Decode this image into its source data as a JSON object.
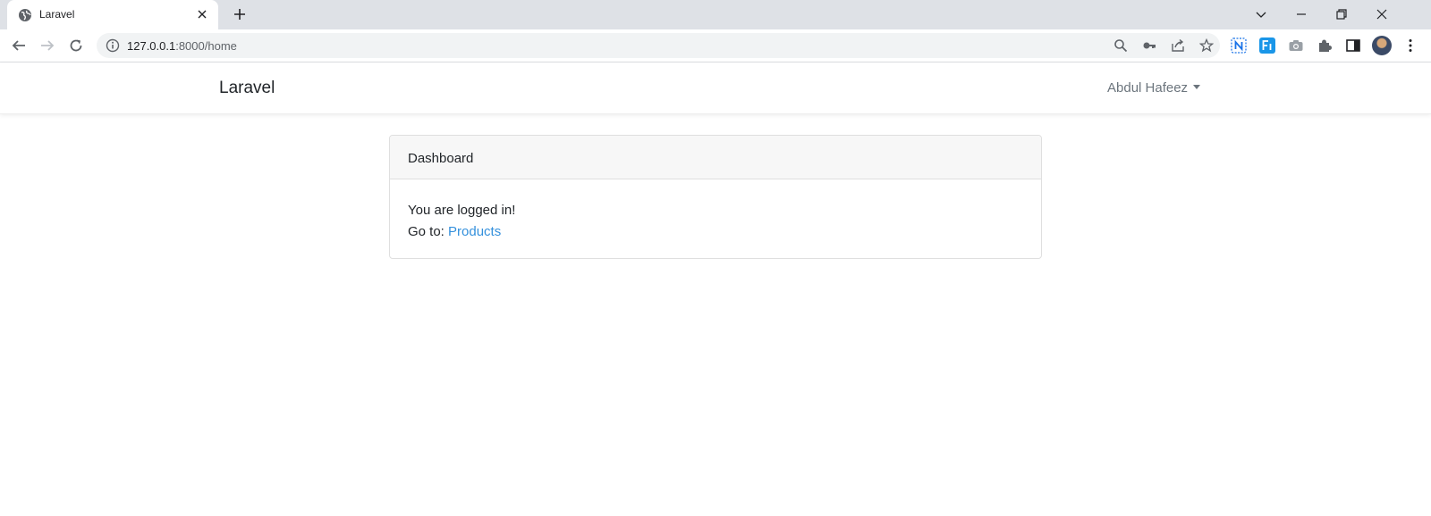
{
  "browser": {
    "tab_title": "Laravel",
    "url_host": "127.0.0.1",
    "url_rest": ":8000/home"
  },
  "navbar": {
    "brand": "Laravel",
    "user_name": "Abdul Hafeez"
  },
  "card": {
    "header": "Dashboard",
    "status_text": "You are logged in!",
    "goto_label": "Go to: ",
    "products_link": "Products"
  },
  "colors": {
    "link": "#3490dc",
    "muted": "#6c757d",
    "tabstrip": "#dee1e6"
  }
}
